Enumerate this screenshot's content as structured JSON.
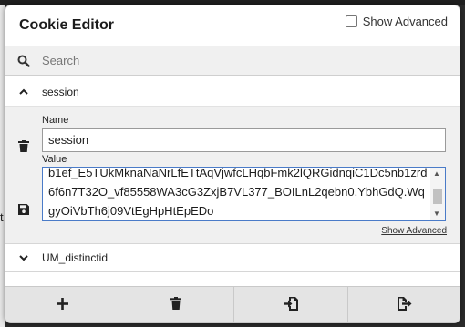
{
  "app": {
    "title": "Cookie Editor",
    "show_advanced_label": "Show Advanced",
    "show_advanced_checked": false
  },
  "search": {
    "placeholder": "Search",
    "value": ""
  },
  "cookies": [
    {
      "name": "session",
      "expanded": true,
      "fields": {
        "name_label": "Name",
        "name_value": "session",
        "value_label": "Value",
        "value": "b1ef_E5TUkMknaNaNrLfETtAqVjwfcLHqbFmk2lQRGidnqiC1Dc5nb1zrd6f6n7T32O_vf85558WA3cG3ZxjB7VL377_BOILnL2qebn0.YbhGdQ.WqgyOiVbTh6j09VtEgHpHtEpEDo"
      },
      "show_advanced_link": "Show Advanced"
    },
    {
      "name": "UM_distinctid",
      "expanded": false
    }
  ],
  "toolbar": {
    "buttons": [
      {
        "icon": "plus-icon"
      },
      {
        "icon": "trash-icon"
      },
      {
        "icon": "import-icon"
      },
      {
        "icon": "export-icon"
      }
    ]
  }
}
